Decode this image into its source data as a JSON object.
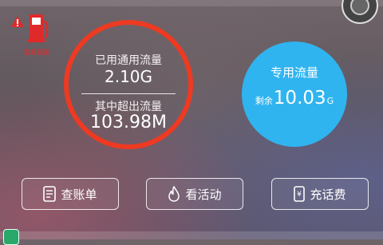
{
  "alert": {
    "caption": "流量超出",
    "color": "#e02a2a"
  },
  "usage": {
    "used_label": "已用通用流量",
    "used_value": "2.10G",
    "exceed_label": "其中超出流量",
    "exceed_value": "103.98M",
    "ring_color": "#ee3a22"
  },
  "special": {
    "title": "专用流量",
    "remain_label": "剩余",
    "remain_value": "10.03",
    "remain_unit": "G",
    "color": "#2fb4f0"
  },
  "actions": {
    "bill": "查账单",
    "activity": "看活动",
    "topup": "充话费"
  },
  "icons": {
    "bill": "document-icon",
    "activity": "flame-icon",
    "topup": "yuan-phone-icon",
    "warning": "warning-triangle-icon",
    "fuel": "fuel-pump-icon"
  }
}
